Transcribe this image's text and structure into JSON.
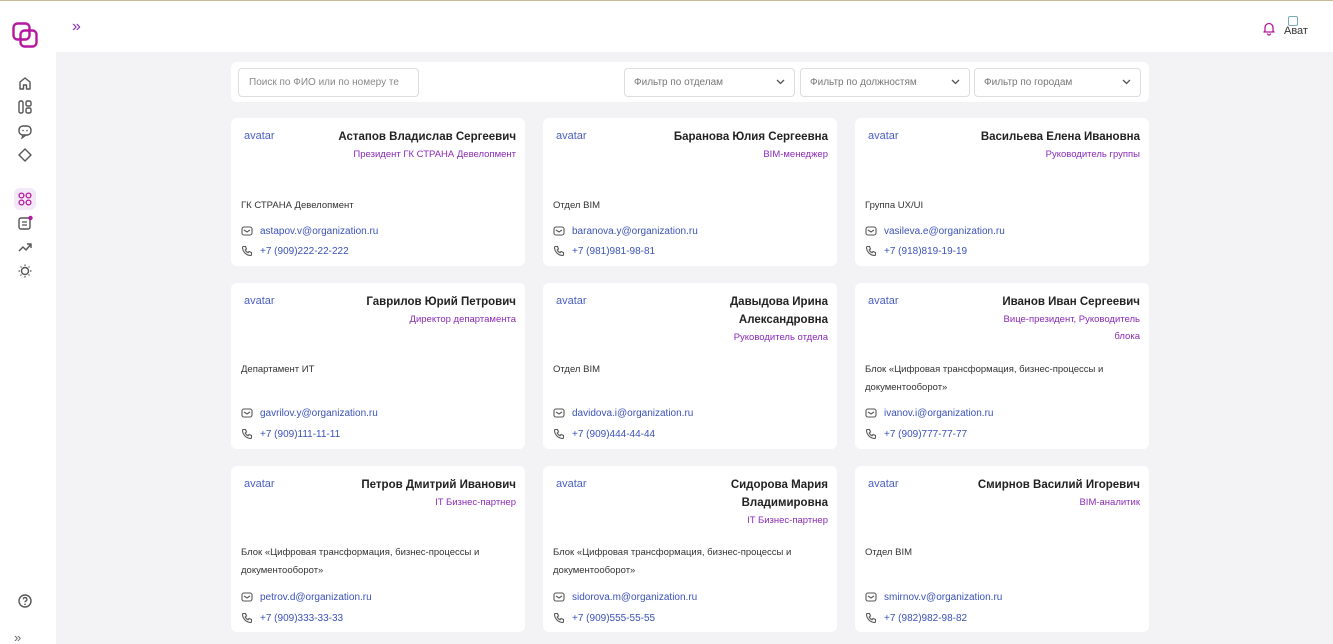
{
  "header": {
    "expand_label": "»",
    "avatar_alt": "Ават"
  },
  "sidebar": {
    "items": [
      {
        "icon": "home-icon"
      },
      {
        "icon": "structure-icon"
      },
      {
        "icon": "chat-icon"
      },
      {
        "icon": "tag-icon"
      },
      {
        "icon": "grid-icon",
        "active": true
      },
      {
        "icon": "document-icon",
        "badge": true
      },
      {
        "icon": "trend-icon"
      },
      {
        "icon": "lightbulb-icon"
      }
    ],
    "help_icon": "help-icon",
    "collapse_label": "»"
  },
  "filters": {
    "search_placeholder": "Поиск по ФИО или по номеру те",
    "department": "Фильтр по отделам",
    "position": "Фильтр по должностям",
    "city": "Фильтр по городам"
  },
  "employees": [
    {
      "avatar": "avatar",
      "name": [
        "Астапов Владислав Сергеевич"
      ],
      "position": [
        "Президент ГК СТРАНА Девелопмент"
      ],
      "department": [
        "ГК СТРАНА Девелопмент"
      ],
      "email": "astapov.v@organization.ru",
      "phone": "+7 (909)222-22-222"
    },
    {
      "avatar": "avatar",
      "name": [
        "Баранова Юлия Сергеевна"
      ],
      "position": [
        "BIM-менеджер"
      ],
      "department": [
        "Отдел BIM"
      ],
      "email": "baranova.y@organization.ru",
      "phone": "+7 (981)981-98-81"
    },
    {
      "avatar": "avatar",
      "name": [
        "Васильева Елена Ивановна"
      ],
      "position": [
        "Руководитель группы"
      ],
      "department": [
        "Группа UX/UI"
      ],
      "email": "vasileva.e@organization.ru",
      "phone": "+7 (918)819-19-19"
    },
    {
      "avatar": "avatar",
      "name": [
        "Гаврилов Юрий Петрович"
      ],
      "position": [
        "Директор департамента"
      ],
      "department": [
        "Департамент ИТ"
      ],
      "email": "gavrilov.y@organization.ru",
      "phone": "+7 (909)111-11-11"
    },
    {
      "avatar": "avatar",
      "name": [
        "Давыдова Ирина",
        "Александровна"
      ],
      "position": [
        "Руководитель отдела"
      ],
      "department": [
        "Отдел BIM"
      ],
      "email": "davidova.i@organization.ru",
      "phone": "+7 (909)444-44-44"
    },
    {
      "avatar": "avatar",
      "name": [
        "Иванов Иван Сергеевич"
      ],
      "position": [
        "Вице-президент, Руководитель",
        "блока"
      ],
      "department": [
        "Блок «Цифровая трансформация, бизнес-процессы и",
        "документооборот»"
      ],
      "email": "ivanov.i@organization.ru",
      "phone": "+7 (909)777-77-77"
    },
    {
      "avatar": "avatar",
      "name": [
        "Петров Дмитрий Иванович"
      ],
      "position": [
        "IT Бизнес-партнер"
      ],
      "department": [
        "Блок «Цифровая трансформация, бизнес-процессы и",
        "документооборот»"
      ],
      "email": "petrov.d@organization.ru",
      "phone": "+7 (909)333-33-33"
    },
    {
      "avatar": "avatar",
      "name": [
        "Сидорова Мария",
        "Владимировна"
      ],
      "position": [
        "IT Бизнес-партнер"
      ],
      "department": [
        "Блок «Цифровая трансформация, бизнес-процессы и",
        "документооборот»"
      ],
      "email": "sidorova.m@organization.ru",
      "phone": "+7 (909)555-55-55"
    },
    {
      "avatar": "avatar",
      "name": [
        "Смирнов Василий Игоревич"
      ],
      "position": [
        "BIM-аналитик"
      ],
      "department": [
        "Отдел BIM"
      ],
      "email": "smirnov.v@organization.ru",
      "phone": "+7 (982)982-98-82"
    }
  ],
  "colors": {
    "accent": "#8b2bb8",
    "link": "#3a52b8",
    "background": "#f3f3f5"
  }
}
